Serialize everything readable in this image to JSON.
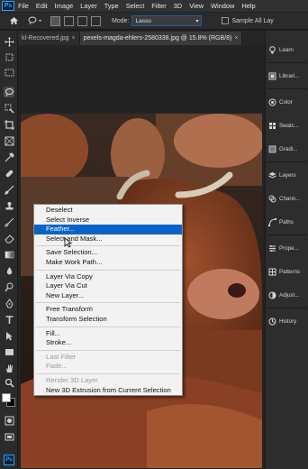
{
  "menubar": {
    "logo": "Ps",
    "items": [
      "File",
      "Edit",
      "Image",
      "Layer",
      "Type",
      "Select",
      "Filter",
      "3D",
      "View",
      "Window",
      "Help"
    ]
  },
  "options": {
    "mode_label": "Mode:",
    "mode_value": "Lasso",
    "sample_label": "Sample All Lay"
  },
  "tabs": [
    {
      "label": "kl-Recovered.jpg",
      "active": false
    },
    {
      "label": "pexels-magda-ehlers-2580338.jpg @ 15.8% (RGB/8)",
      "active": true
    }
  ],
  "right_panel": [
    {
      "label": "Learn",
      "icon": "bulb-icon"
    },
    {
      "label": "Librari...",
      "icon": "library-icon"
    },
    {
      "label": "Color",
      "icon": "color-icon"
    },
    {
      "label": "Swatc...",
      "icon": "swatches-icon"
    },
    {
      "label": "Gradi...",
      "icon": "gradients-icon"
    },
    {
      "label": "Layers",
      "icon": "layers-icon"
    },
    {
      "label": "Chann...",
      "icon": "channels-icon"
    },
    {
      "label": "Paths",
      "icon": "paths-icon"
    },
    {
      "label": "Prope...",
      "icon": "properties-icon"
    },
    {
      "label": "Patterns",
      "icon": "patterns-icon"
    },
    {
      "label": "Adjust...",
      "icon": "adjustments-icon"
    },
    {
      "label": "History",
      "icon": "history-icon"
    }
  ],
  "context_menu": {
    "groups": [
      [
        {
          "label": "Deselect",
          "state": "normal"
        },
        {
          "label": "Select Inverse",
          "state": "normal"
        },
        {
          "label": "Feather...",
          "state": "highlighted"
        },
        {
          "label": "Select and Mask...",
          "state": "normal"
        }
      ],
      [
        {
          "label": "Save Selection...",
          "state": "normal"
        },
        {
          "label": "Make Work Path...",
          "state": "normal"
        }
      ],
      [
        {
          "label": "Layer Via Copy",
          "state": "normal"
        },
        {
          "label": "Layer Via Cut",
          "state": "normal"
        },
        {
          "label": "New Layer...",
          "state": "normal"
        }
      ],
      [
        {
          "label": "Free Transform",
          "state": "normal"
        },
        {
          "label": "Transform Selection",
          "state": "normal"
        }
      ],
      [
        {
          "label": "Fill...",
          "state": "normal"
        },
        {
          "label": "Stroke...",
          "state": "normal"
        }
      ],
      [
        {
          "label": "Last Filter",
          "state": "disabled"
        },
        {
          "label": "Fade...",
          "state": "disabled"
        }
      ],
      [
        {
          "label": "Render 3D Layer",
          "state": "disabled"
        },
        {
          "label": "New 3D Extrusion from Current Selection",
          "state": "normal"
        }
      ]
    ]
  },
  "taskbar": {
    "app": "Ps"
  },
  "colors": {
    "accent": "#0a64c8",
    "foreground_swatch": "#ffffff",
    "background_swatch": "#000000"
  }
}
